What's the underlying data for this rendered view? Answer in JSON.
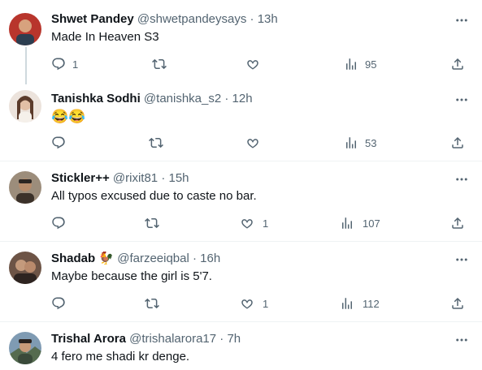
{
  "tweets": [
    {
      "name": "Shwet Pandey",
      "handle": "@shwetpandeysays",
      "time": "13h",
      "text": "Made In Heaven S3",
      "replies": "1",
      "retweets": "",
      "likes": "",
      "views": "95",
      "avatar_colors": [
        "#c0392b",
        "#2c3e50"
      ]
    },
    {
      "name": "Tanishka Sodhi",
      "handle": "@tanishka_s2",
      "time": "12h",
      "text": "😂😂",
      "replies": "",
      "retweets": "",
      "likes": "",
      "views": "53",
      "avatar_colors": [
        "#e8d8cf",
        "#6b4c3b"
      ]
    },
    {
      "name": "Stickler++",
      "handle": "@rixit81",
      "time": "15h",
      "text": "All typos excused due to caste no bar.",
      "replies": "",
      "retweets": "",
      "likes": "1",
      "views": "107",
      "avatar_colors": [
        "#8a7a6a",
        "#3b3129"
      ]
    },
    {
      "name": "Shadab",
      "handle": "@farzeeiqbal",
      "time": "16h",
      "text": "Maybe because the girl is 5'7.",
      "replies": "",
      "retweets": "",
      "likes": "1",
      "views": "112",
      "avatar_colors": [
        "#7a5a4a",
        "#2e2420"
      ],
      "badge": "🐓"
    },
    {
      "name": "Trishal Arora",
      "handle": "@trishalarora17",
      "time": "7h",
      "text": "4 fero me shadi kr denge.",
      "avatar_colors": [
        "#6f8fa8",
        "#3a4a3a"
      ]
    }
  ],
  "separator": "·",
  "icons": {
    "reply": "reply-icon",
    "retweet": "retweet-icon",
    "like": "heart-icon",
    "views": "views-icon",
    "share": "share-icon",
    "more": "more-icon"
  },
  "colors": {
    "text_primary": "#0f1419",
    "text_secondary": "#536471",
    "divider": "#eff3f4",
    "thread_line": "#cfd9de"
  }
}
